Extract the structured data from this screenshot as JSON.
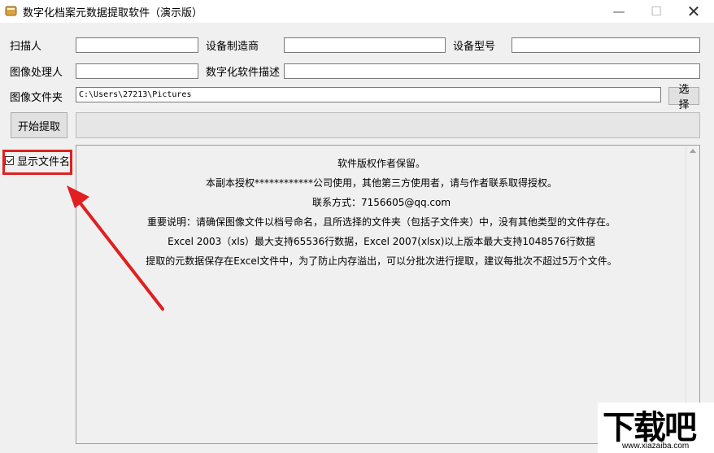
{
  "window": {
    "title": "数字化档案元数据提取软件（演示版）",
    "minimize_glyph": "—",
    "maximize_glyph": "☐",
    "close_glyph": "✕"
  },
  "form": {
    "scanner_label": "扫描人",
    "scanner_value": "",
    "device_maker_label": "设备制造商",
    "device_maker_value": "",
    "device_model_label": "设备型号",
    "device_model_value": "",
    "image_processor_label": "图像处理人",
    "image_processor_value": "",
    "software_desc_label": "数字化软件描述",
    "software_desc_value": "",
    "image_folder_label": "图像文件夹",
    "image_folder_value": "C:\\Users\\27213\\Pictures",
    "select_button": "选择",
    "start_button": "开始提取",
    "progress": 0
  },
  "options": {
    "show_filename_label": "显示文件名",
    "show_filename_checked": true
  },
  "info": {
    "lines": [
      "软件版权作者保留。",
      "本副本授权************公司使用，其他第三方使用者，请与作者联系取得授权。",
      "联系方式：7156605@qq.com",
      "重要说明：请确保图像文件以档号命名，且所选择的文件夹（包括子文件夹）中，没有其他类型的文件存在。",
      "Excel 2003（xls）最大支持65536行数据，Excel 2007(xlsx)以上版本最大支持1048576行数据",
      "提取的元数据保存在Excel文件中，为了防止内存溢出，可以分批次进行提取，建议每批次不超过5万个文件。"
    ]
  },
  "watermark": {
    "brand": "下载吧",
    "url": "www.xiazaiba.com"
  },
  "colors": {
    "annotation": "#e02020",
    "window_bg": "#f0f0f0"
  },
  "icons": {
    "app": "app-icon",
    "checkbox": "checkmark-icon",
    "scroll": "scroll-up-arrow-icon"
  }
}
